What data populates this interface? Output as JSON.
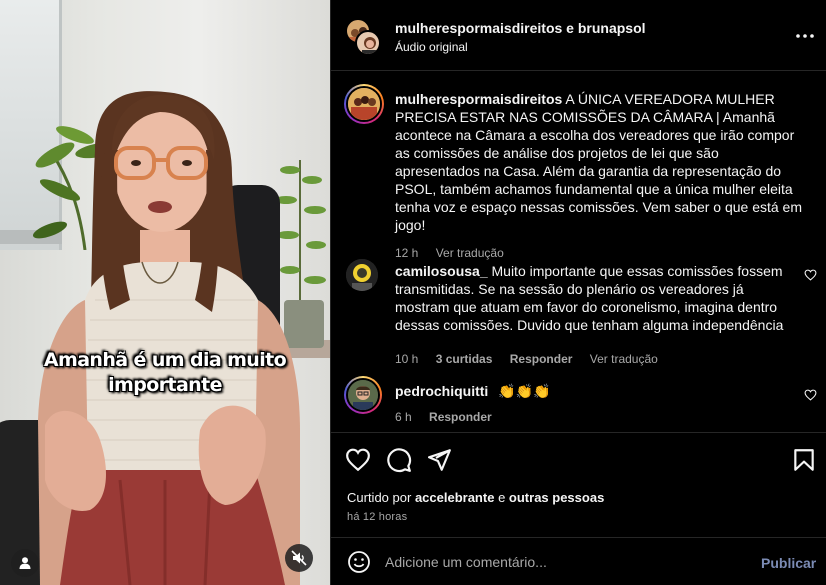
{
  "video": {
    "caption_line1": "Amanhã é um dia muito",
    "caption_line2": "importante",
    "user_tag_icon": "person-icon",
    "mute_icon": "speaker-muted-icon"
  },
  "header": {
    "title": "mulherespormaisdireitos e brunapsol",
    "subtitle": "Áudio original",
    "more_icon": "more-horizontal-icon"
  },
  "post_caption": {
    "username": "mulherespormaisdireitos",
    "text": "A ÚNICA VEREADORA MULHER PRECISA ESTAR NAS COMISSÕES DA CÂMARA | Amanhã acontece na Câmara a escolha dos vereadores que irão compor as comissões de análise dos projetos de lei que são apresentados na Casa. Além da garantia da representação do PSOL, também achamos fundamental que a única mulher eleita tenha voz e espaço nessas comissões. Vem saber o que está em jogo!",
    "time": "12 h",
    "see_translation": "Ver tradução"
  },
  "comments": [
    {
      "username": "camilosousa_",
      "text": "Muito importante que essas comissões fossem transmitidas. Se na sessão do plenário os vereadores já mostram que atuam em favor do coronelismo, imagina dentro dessas comissões. Duvido que tenham alguma independência",
      "time": "10 h",
      "likes": "3 curtidas",
      "reply": "Responder",
      "see_translation": "Ver tradução"
    },
    {
      "username": "pedrochiquitti",
      "text": "👏👏👏",
      "time": "6 h",
      "reply": "Responder"
    }
  ],
  "actions": {
    "like_icon": "heart-icon",
    "comment_icon": "comment-icon",
    "share_icon": "send-icon",
    "save_icon": "bookmark-icon"
  },
  "likes": {
    "prefix": "Curtido por",
    "user": "accelebrante",
    "conjunction": "e",
    "others": "outras pessoas"
  },
  "post_time": "há 12 horas",
  "comment_box": {
    "placeholder": "Adicione um comentário...",
    "publish": "Publicar",
    "emoji_icon": "emoji-icon"
  },
  "colors": {
    "background": "#000000",
    "text": "#f5f5f5",
    "secondary_text": "#a8a8a8",
    "publish_disabled": "#7b8bb4",
    "divider": "#262626"
  }
}
